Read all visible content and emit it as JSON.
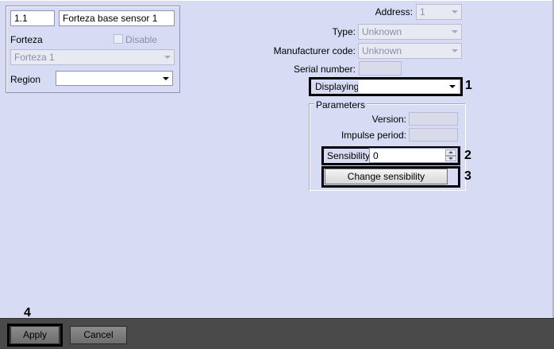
{
  "object": {
    "id": "1.1",
    "name": "Forteza base sensor 1",
    "type_label": "Forteza",
    "disable_label": "Disable",
    "disable_checked": false,
    "parent_value": "Forteza 1",
    "region_label": "Region",
    "region_value": ""
  },
  "properties": {
    "address_label": "Address:",
    "address_value": "1",
    "type_label": "Type:",
    "type_value": "Unknown",
    "manufacturer_label": "Manufacturer code:",
    "manufacturer_value": "Unknown",
    "serial_label": "Serial number:",
    "serial_value": "",
    "displaying_label": "Displaying:",
    "displaying_value": ""
  },
  "parameters": {
    "group_title": "Parameters",
    "version_label": "Version:",
    "version_value": "",
    "impulse_label": "Impulse period:",
    "impulse_value": "",
    "sensibility_label": "Sensibility:",
    "sensibility_value": "0",
    "change_button": "Change sensibility"
  },
  "callouts": [
    "1",
    "2",
    "3",
    "4"
  ],
  "footer": {
    "apply_label": "Apply",
    "cancel_label": "Cancel"
  },
  "colors": {
    "background": "#d7dcf4",
    "footer": "#4a4a4a",
    "callout": "#000000"
  }
}
